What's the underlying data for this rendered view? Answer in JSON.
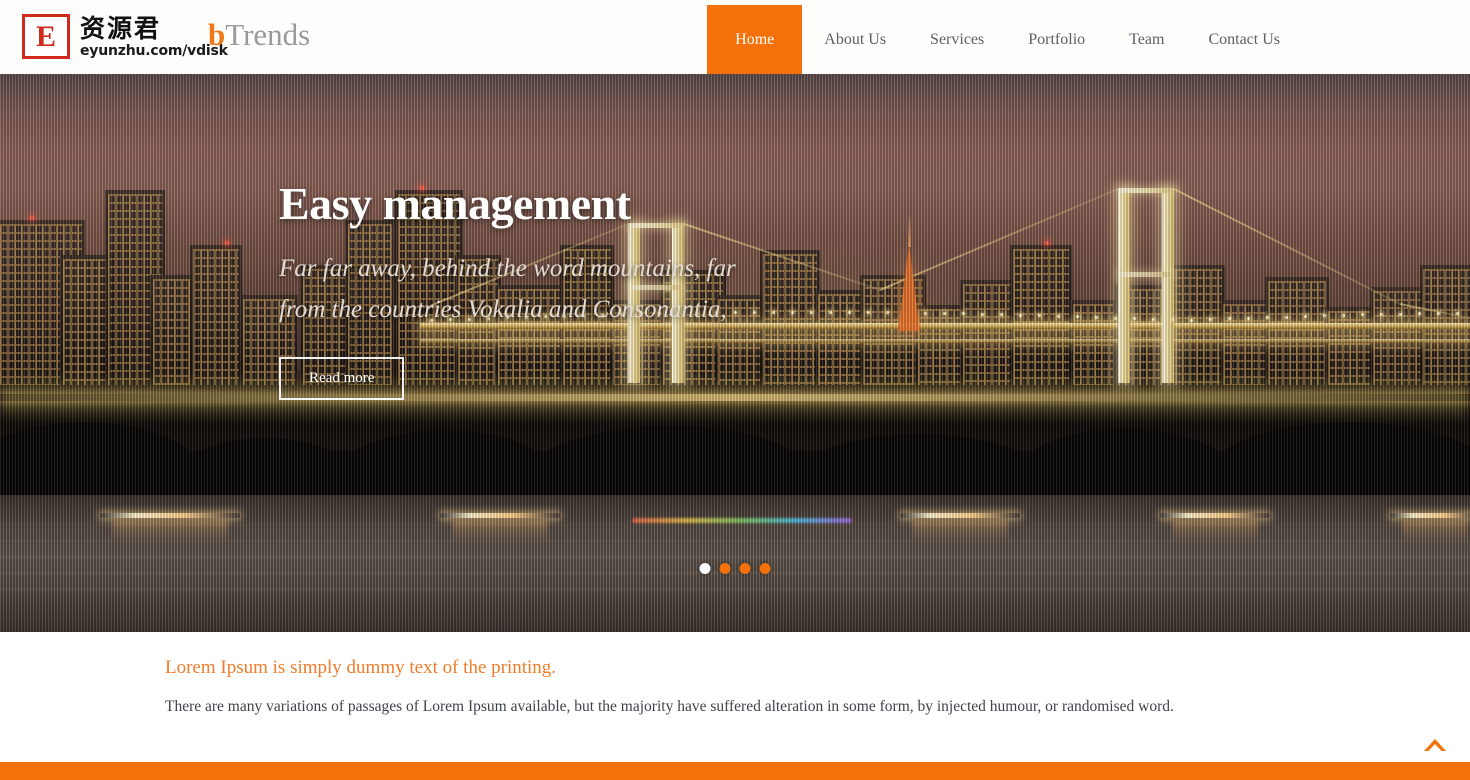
{
  "theme": {
    "accent": "#f5710a",
    "accent_text": "#f07c2a",
    "logo_red": "#cf2a1b",
    "nav_text": "#5c5f63",
    "body_text": "#3f4349"
  },
  "header": {
    "logo": {
      "mark_letter": "E",
      "cn_name": "资源君",
      "url": "eyunzhu.com/vdisk"
    },
    "site_name": {
      "accent_part": "b",
      "rest_part": "Trends"
    },
    "nav": [
      {
        "label": "Home",
        "active": true
      },
      {
        "label": "About Us",
        "active": false
      },
      {
        "label": "Services",
        "active": false
      },
      {
        "label": "Portfolio",
        "active": false
      },
      {
        "label": "Team",
        "active": false
      },
      {
        "label": "Contact Us",
        "active": false
      }
    ]
  },
  "hero": {
    "heading": "Easy management",
    "subheading": "Far far away, behind the word mountains, far from the countries Vokalia and Consonantia,",
    "cta_label": "Read more",
    "slider": {
      "total": 4,
      "active_index": 0
    }
  },
  "content": {
    "heading": "Lorem Ipsum is simply dummy text of the printing.",
    "paragraph": "There are many variations of passages of Lorem Ipsum available, but the majority have suffered alteration in some form, by injected humour, or randomised word."
  },
  "footer": {
    "scroll_top_icon": "chevron-up-icon"
  }
}
